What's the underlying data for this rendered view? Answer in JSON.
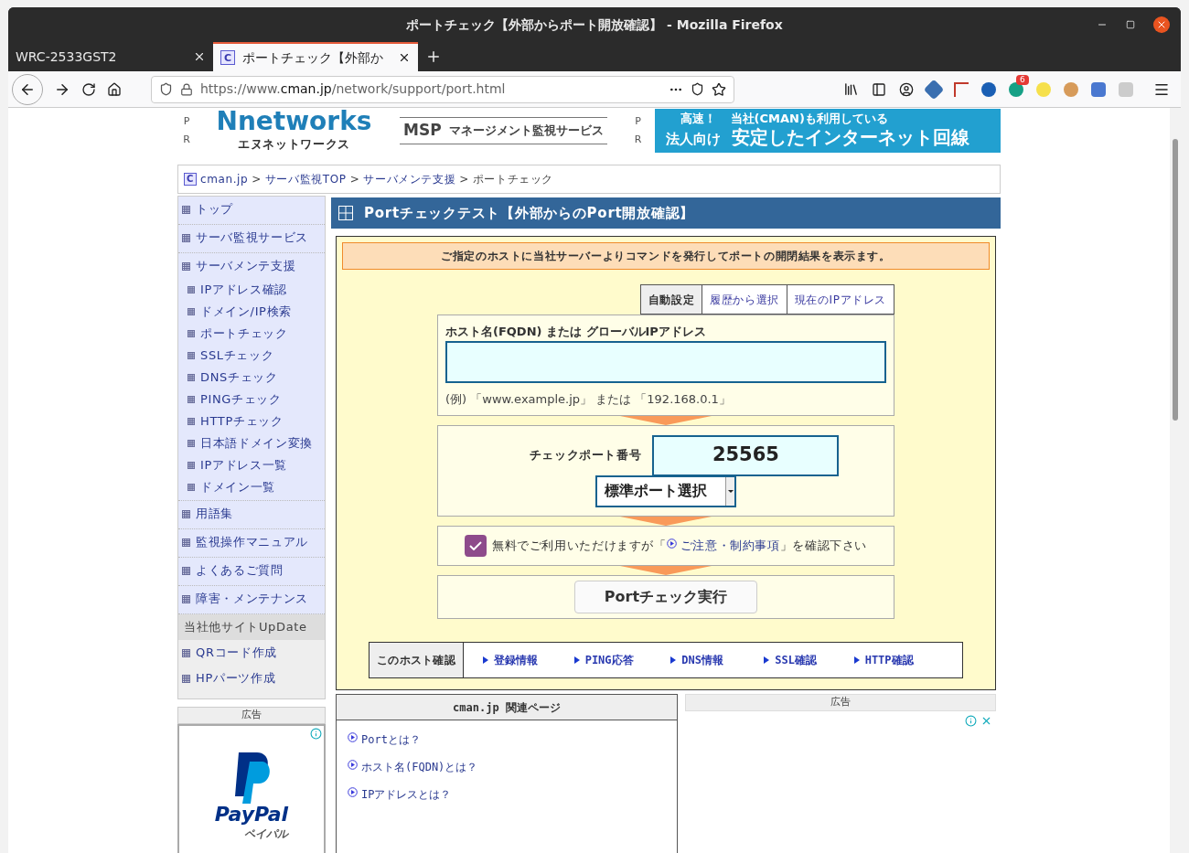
{
  "window": {
    "title": "ポートチェック【外部からポート開放確認】 - Mozilla Firefox"
  },
  "tabs": [
    {
      "label": "WRC-2533GST2",
      "selected": false
    },
    {
      "label": "ポートチェック【外部か",
      "selected": true,
      "icon_letter": "C"
    }
  ],
  "address_bar": {
    "url_prefix": "https://www.",
    "url_domain": "cman.jp",
    "url_path": "/network/support/port.html"
  },
  "toolbar_badge": "6",
  "header": {
    "pr_marks": [
      "P",
      "R"
    ],
    "logo": "Nnetworks",
    "logo_sub": "エヌネットワークス",
    "msp_prefix": "MSP",
    "msp_text": "マネージメント監視サービス",
    "pr_marks_2": [
      "P",
      "R"
    ],
    "ad_line_1a": "高速！",
    "ad_line_1b": "当社(CMAN)も利用している",
    "ad_line_2a": "法人向け",
    "ad_line_2b": "安定したインターネット回線"
  },
  "breadcrumb": [
    {
      "label": "cman.jp",
      "link": true
    },
    {
      "label": "サーバ監視TOP",
      "link": true
    },
    {
      "label": "サーバメンテ支援",
      "link": true
    },
    {
      "label": "ポートチェック",
      "link": false
    }
  ],
  "breadcrumb_separator": ">",
  "breadcrumb_icon_letter": "C",
  "sidebar": {
    "items": [
      {
        "label": "トップ"
      },
      {
        "label": "サーバ監視サービス"
      },
      {
        "label": "サーバメンテ支援",
        "children": [
          {
            "label": "IPアドレス確認"
          },
          {
            "label": "ドメイン/IP検索"
          },
          {
            "label": "ポートチェック"
          },
          {
            "label": "SSLチェック"
          },
          {
            "label": "DNSチェック"
          },
          {
            "label": "PINGチェック"
          },
          {
            "label": "HTTPチェック"
          },
          {
            "label": "日本語ドメイン変換"
          },
          {
            "label": "IPアドレス一覧"
          },
          {
            "label": "ドメイン一覧"
          }
        ]
      },
      {
        "label": "用語集"
      },
      {
        "label": "監視操作マニュアル"
      },
      {
        "label": "よくあるご質問"
      },
      {
        "label": "障害・メンテナンス"
      }
    ]
  },
  "other_sites": {
    "title": "当社他サイトUpDate",
    "items": [
      "QRコード作成",
      "HPパーツ作成"
    ]
  },
  "sidebar_ad": {
    "label": "広告",
    "brand": "PayPal",
    "brand_kana": "ペイパル"
  },
  "main": {
    "title": "Portチェックテスト【外部からのPort開放確認】",
    "intro": "ご指定のホストに当社サーバーよりコマンドを発行してポートの開閉結果を表示ます。",
    "mode_tabs": [
      {
        "label": "自動設定",
        "selected": true
      },
      {
        "label": "履歴から選択",
        "selected": false
      },
      {
        "label": "現在のIPアドレス",
        "selected": false
      }
    ],
    "host_label": "ホスト名(FQDN) または グローバルIPアドレス",
    "host_example": "(例) 「www.example.jp」 または 「192.168.0.1」",
    "port_label": "チェックポート番号",
    "port_value": "25565",
    "port_select": "標準ポート選択",
    "agree": {
      "checked": true,
      "before": "無料でご利用いただけますが「",
      "link": "ご注意・制約事項",
      "after": "」を確認下さい"
    },
    "submit": "Portチェック実行",
    "host_links": {
      "title": "このホスト確認",
      "links": [
        "登録情報",
        "PING応答",
        "DNS情報",
        "SSL確認",
        "HTTP確認"
      ]
    }
  },
  "related": {
    "title": "cman.jp 関連ページ",
    "links": [
      "Portとは？",
      "ホスト名(FQDN)とは？",
      "IPアドレスとは？"
    ]
  },
  "ad_label": "広告"
}
